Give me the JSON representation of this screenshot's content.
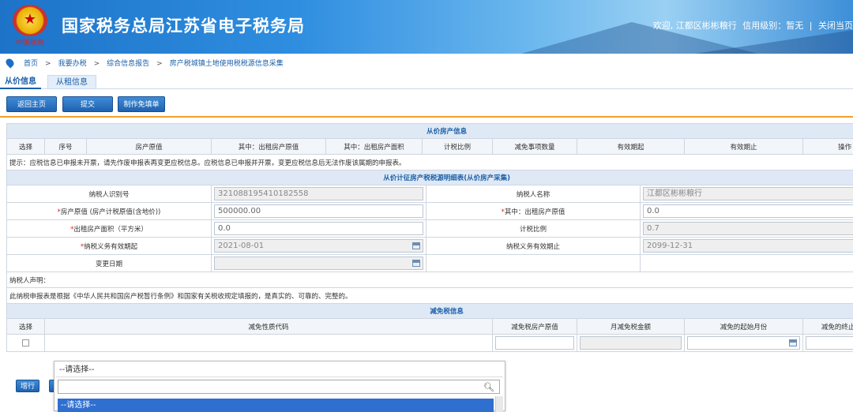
{
  "header": {
    "emblem_text": "中国税务",
    "title": "国家税务总局江苏省电子税务局",
    "welcome": "欢迎, 江都区彬彬粮行",
    "credit": "信用级别：暂无",
    "divider": "|",
    "close": "关闭当页"
  },
  "breadcrumb": {
    "items": [
      "首页",
      "我要办税",
      "综合信息报告",
      "房产税城镇土地使用税税源信息采集"
    ],
    "separator": ">"
  },
  "tabs": [
    "从价信息",
    "从租信息"
  ],
  "actions": [
    "返回主页",
    "提交",
    "制作免填单"
  ],
  "property_section": {
    "title": "从价房产信息",
    "columns": [
      "选择",
      "序号",
      "房产原值",
      "其中：出租房产原值",
      "其中：出租房产面积",
      "计税比例",
      "减免事项数量",
      "有效期起",
      "有效期止",
      "操作"
    ],
    "hint": "提示：应税信息已申报未开票，请先作废申报表再变更应税信息。应税信息已申报并开票，变更应税信息后无法作废该属期的申报表。"
  },
  "detail_section": {
    "title": "从价计征房产税税源明细表(从价房产采集)",
    "taxpayer_id_label": "纳税人识别号",
    "taxpayer_id_value": "321088195410182558",
    "taxpayer_name_label": "纳税人名称",
    "taxpayer_name_value": "江都区彬彬粮行",
    "original_value_label": "房产原值 (房产计税原值(含地价))",
    "original_value_value": "500000.00",
    "rent_original_label": "其中：出租房产原值",
    "rent_original_value": "0.0",
    "rent_area_label": "出租房产面积（平方米）",
    "rent_area_value": "0.0",
    "tax_ratio_label": "计税比例",
    "tax_ratio_value": "0.7",
    "duty_start_label": "纳税义务有效期起",
    "duty_start_value": "2021-08-01",
    "duty_end_label": "纳税义务有效期止",
    "duty_end_value": "2099-12-31",
    "change_date_label": "变更日期",
    "change_date_value": "",
    "required_mark": "*",
    "declaration_label": "纳税人声明：",
    "declaration_text": "此纳税申报表是根据《中华人民共和国房产税暂行条例》和国家有关税收规定填报的，是真实的、可靠的、完整的。"
  },
  "relief_section": {
    "title": "减免税信息",
    "columns": [
      "选择",
      "减免性质代码",
      "减免税房产原值",
      "月减免税金额",
      "减免的起始月份",
      "减免的终止月份"
    ]
  },
  "dropdown": {
    "selected": "--请选择--",
    "search_placeholder": "",
    "option_highlight": "--请选择--"
  },
  "add_row_button": "增行",
  "colors": {
    "header_blue": "#1d73c8",
    "link_blue": "#1a5fa8",
    "button_blue": "#1f62b0",
    "section_bg": "#dfe9f5",
    "orange_rule": "#f0a02a",
    "highlight": "#2f6fd0"
  }
}
